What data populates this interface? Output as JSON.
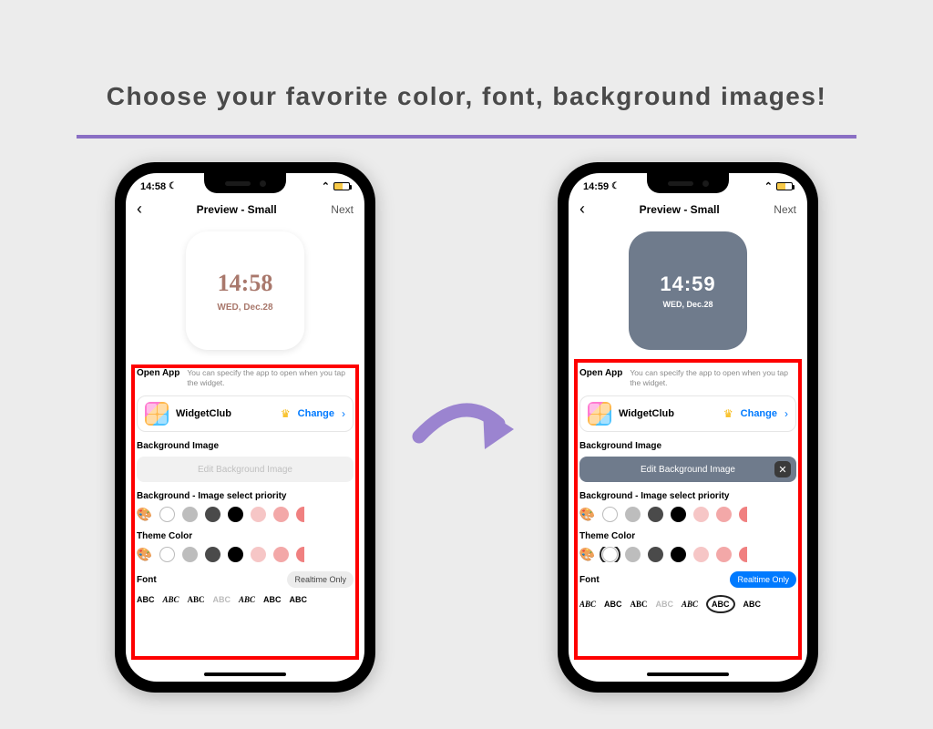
{
  "headline": "Choose your favorite color, font, background images!",
  "nav": {
    "title": "Preview - Small",
    "next": "Next"
  },
  "status": {
    "t1": "14:58",
    "t2": "14:59"
  },
  "widget": {
    "time1": "14:58",
    "date1": "WED, Dec.28",
    "time2": "14:59",
    "date2": "WED, Dec.28"
  },
  "openapp": {
    "label": "Open App",
    "hint": "You can specify the app to open when you tap the widget.",
    "appname": "WidgetClub",
    "change": "Change"
  },
  "bg": {
    "label": "Background Image",
    "btn_pale": "Edit Background Image",
    "btn_dark": "Edit Background Image"
  },
  "priority": {
    "label": "Background - Image select priority"
  },
  "theme": {
    "label": "Theme Color"
  },
  "font": {
    "label": "Font",
    "pill": "Realtime Only"
  },
  "swatch_colors": [
    "#ffffff",
    "#bdbdbd",
    "#4a4a4a",
    "#000000",
    "#f6c6c6",
    "#f3a8a8"
  ],
  "swatch_overflow": "#f08080",
  "abc": "ABC"
}
